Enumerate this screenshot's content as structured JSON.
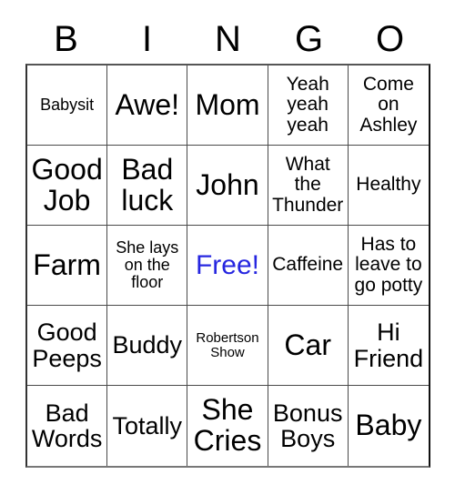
{
  "card": {
    "title": "BINGO",
    "header_letters": [
      "B",
      "I",
      "N",
      "G",
      "O"
    ],
    "free_color": "#2626e0",
    "text_color": "#000000",
    "grid_line_color": "#4a4a4a",
    "background": "#ffffff",
    "rows": 5,
    "columns": 5,
    "cells": [
      {
        "text": "Babysit",
        "size": "sm",
        "free": false
      },
      {
        "text": "Awe!",
        "size": "xl",
        "free": false
      },
      {
        "text": "Mom",
        "size": "xl",
        "free": false
      },
      {
        "text": "Yeah yeah yeah",
        "size": "md",
        "free": false
      },
      {
        "text": "Come on Ashley",
        "size": "md",
        "free": false
      },
      {
        "text": "Good Job",
        "size": "xl",
        "free": false
      },
      {
        "text": "Bad luck",
        "size": "xl",
        "free": false
      },
      {
        "text": "John",
        "size": "xl",
        "free": false
      },
      {
        "text": "What the Thunder",
        "size": "md",
        "free": false
      },
      {
        "text": "Healthy",
        "size": "md",
        "free": false
      },
      {
        "text": "Farm",
        "size": "xl",
        "free": false
      },
      {
        "text": "She lays on the floor",
        "size": "sm",
        "free": false
      },
      {
        "text": "Free!",
        "size": "lg",
        "free": true
      },
      {
        "text": "Caffeine",
        "size": "md",
        "free": false
      },
      {
        "text": "Has to leave to go potty",
        "size": "md",
        "free": false
      },
      {
        "text": "Good Peeps",
        "size": "lg",
        "free": false
      },
      {
        "text": "Buddy",
        "size": "lg",
        "free": false
      },
      {
        "text": "Robertson Show",
        "size": "xs",
        "free": false
      },
      {
        "text": "Car",
        "size": "xl",
        "free": false
      },
      {
        "text": "Hi Friend",
        "size": "lg",
        "free": false
      },
      {
        "text": "Bad Words",
        "size": "lg",
        "free": false
      },
      {
        "text": "Totally",
        "size": "lg",
        "free": false
      },
      {
        "text": "She Cries",
        "size": "xl",
        "free": false
      },
      {
        "text": "Bonus Boys",
        "size": "lg",
        "free": false
      },
      {
        "text": "Baby",
        "size": "xl",
        "free": false
      }
    ]
  }
}
